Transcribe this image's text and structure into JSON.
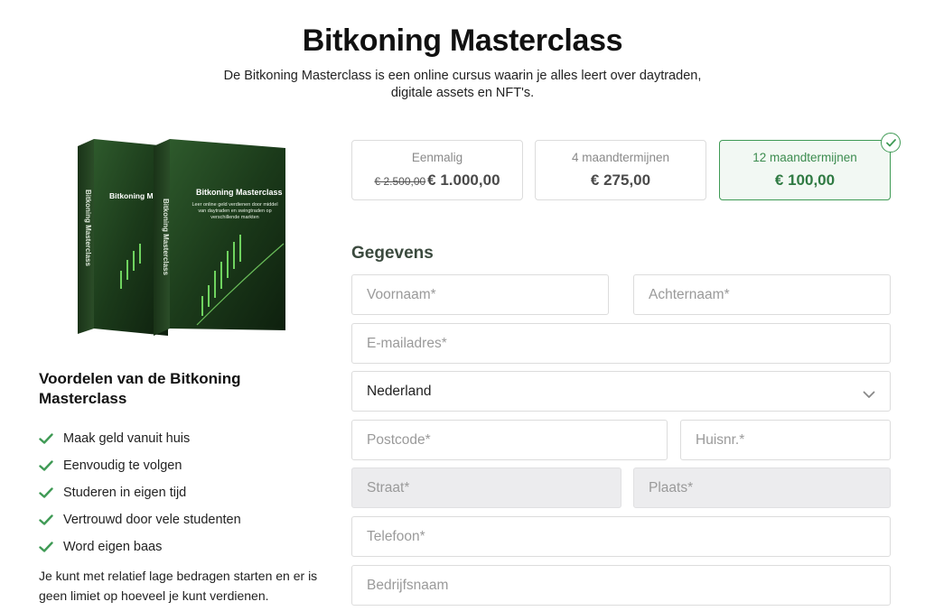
{
  "header": {
    "title": "Bitkoning Masterclass",
    "subtitle": "De Bitkoning Masterclass is een online cursus waarin je alles leert over daytraden, digitale assets en NFT's."
  },
  "product": {
    "box_title": "Bitkoning Masterclass",
    "spine_text": "Bitkoning Masterclass",
    "box_description": "Leer online geld verdienen door middel van daytraden en swingtraden op verschillende markten"
  },
  "benefits": {
    "title": "Voordelen van de Bitkoning Masterclass",
    "items": [
      "Maak geld vanuit huis",
      "Eenvoudig te volgen",
      "Studeren in eigen tijd",
      "Vertrouwd door vele studenten",
      "Word eigen baas"
    ],
    "note": "Je kunt met relatief lage bedragen starten en er is geen limiet op hoeveel je kunt verdienen."
  },
  "plans": [
    {
      "name": "Eenmalig",
      "old_price": "€ 2.500,00",
      "price": "€ 1.000,00",
      "selected": false
    },
    {
      "name": "4 maandtermijnen",
      "price": "€ 275,00",
      "selected": false
    },
    {
      "name": "12 maandtermijnen",
      "price": "€ 100,00",
      "selected": true
    }
  ],
  "form": {
    "title": "Gegevens",
    "first_name": "Voornaam*",
    "last_name": "Achternaam*",
    "email": "E-mailadres*",
    "country": "Nederland",
    "postcode": "Postcode*",
    "house_number": "Huisnr.*",
    "street": "Straat*",
    "city": "Plaats*",
    "phone": "Telefoon*",
    "company": "Bedrijfsnaam"
  },
  "colors": {
    "accent": "#3f9a55",
    "accent_dark": "#2f7a42",
    "border": "#dcdcdc",
    "disabled_bg": "#ececee"
  }
}
